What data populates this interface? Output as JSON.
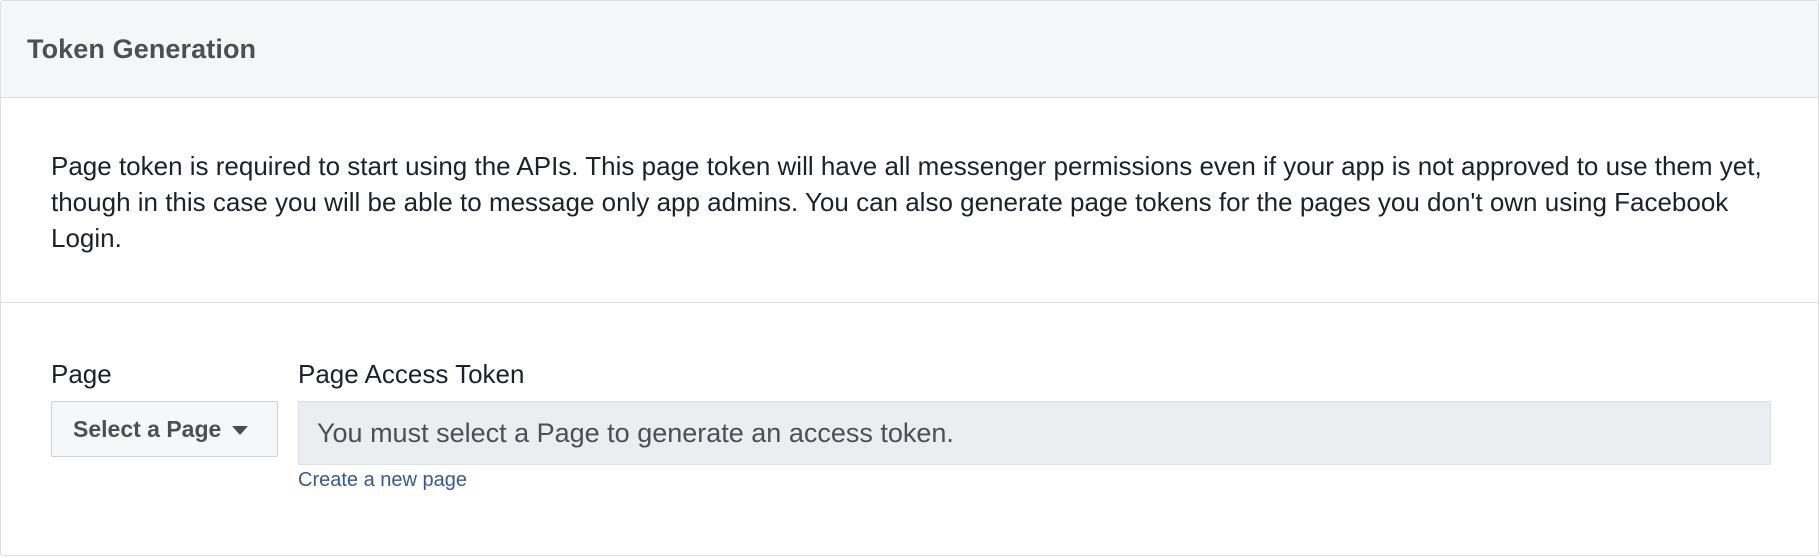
{
  "header": {
    "title": "Token Generation"
  },
  "description": {
    "text": "Page token is required to start using the APIs. This page token will have all messenger permissions even if your app is not approved to use them yet, though in this case you will be able to message only app admins. You can also generate page tokens for the pages you don't own using Facebook Login."
  },
  "form": {
    "page_label": "Page",
    "page_select": {
      "selected": "Select a Page",
      "icon": "caret-down-icon"
    },
    "token_label": "Page Access Token",
    "token_field": {
      "value": "You must select a Page to generate an access token."
    },
    "create_page_link": "Create a new page"
  },
  "colors": {
    "header_bg": "#f5f6f7",
    "border": "#dddfe2",
    "token_field_bg": "#ebedf0",
    "link": "#365899",
    "title_text": "#4b4f56"
  }
}
